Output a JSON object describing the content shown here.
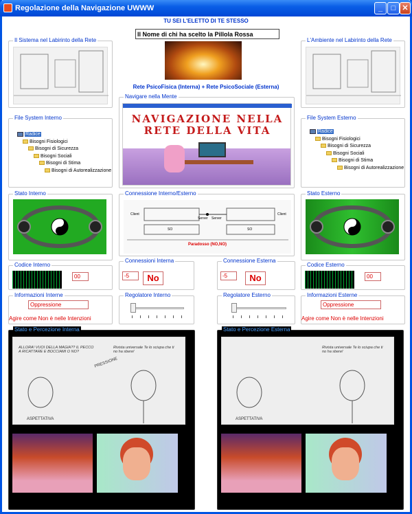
{
  "window": {
    "title": "Regolazione della Navigazione UWWW"
  },
  "header": {
    "tagline": "TU SEI L'ELETTO DI TE STESSO",
    "name_field": "Il Nome di chi  ha scelto la Pillola Rossa",
    "network_caption": "Rete PsicoFisica (Interna) + Rete PsicoSociale (Esterna)"
  },
  "left": {
    "system_label": "Il Sistema nel Labirinto della Rete",
    "fs_label": "File System Interno",
    "tree": [
      "Radice",
      "Bisogni Fisiologici",
      "Bisogni di Sicurezza",
      "Bisogni Sociali",
      "Bisogni di Stima",
      "Bisogni di Autorealizzazione"
    ],
    "state_label": "Stato  Interno",
    "code_label": "Codice Interno",
    "code_value": "00",
    "conn_label": "Connessioni Interna",
    "conn_value": "-5",
    "conn_status": "No",
    "info_label": "Informazioni Interne",
    "info_value": "Oppressione",
    "info_message": "Agire come Non è nelle Intenzioni",
    "reg_label": "Regolatore Interno",
    "perception_label": "Stato e Percezione Interna"
  },
  "right": {
    "system_label": "L'Ambiente nel Labirinto della Rete",
    "fs_label": "File System Esterno",
    "tree": [
      "Radice",
      "Bisogni Fisiologici",
      "Bisogni di Sicurezza",
      "Bisogni Sociali",
      "Bisogni di Stima",
      "Bisogni di Autorealizzazione"
    ],
    "state_label": "Stato Esterno",
    "code_label": "Codice Esterno",
    "code_value": "00",
    "conn_label": "Connessione Esterna",
    "conn_value": "-5",
    "conn_status": "No",
    "info_label": "Informazioni Esterne",
    "info_value": "Oppressione",
    "info_message": "Agire come Non è nelle Intenzioni",
    "reg_label": "Regolatore Esterno",
    "perception_label": "Stato e Percezione Esterna"
  },
  "center": {
    "mind_label": "Navigare nella Mente",
    "mind_banner": "NAVIGAZIONE NELLA RETE DELLA VITA",
    "connection_label": "Connessione Interno/Esterno",
    "diagram_caption": "Paradosso (NO,NO)",
    "diagram_nodes": [
      "Client",
      "SO",
      "Server",
      "Server",
      "SO",
      "Client"
    ]
  },
  "cartoon": {
    "bubble1": "ALLORA! VUOI DELLA MAGIA?? IL PECCO A RICATTARE E BOCCIAMI O NO?",
    "bubble2": "Rivista universale Te lo sciupa che ti no ha sbere!",
    "label_pressione": "PRESSIONE",
    "label_asp": "ASPETTATIVA"
  },
  "colors": {
    "title_blue": "#0054e3",
    "accent_blue": "#0033cc",
    "red": "#dd0000"
  }
}
